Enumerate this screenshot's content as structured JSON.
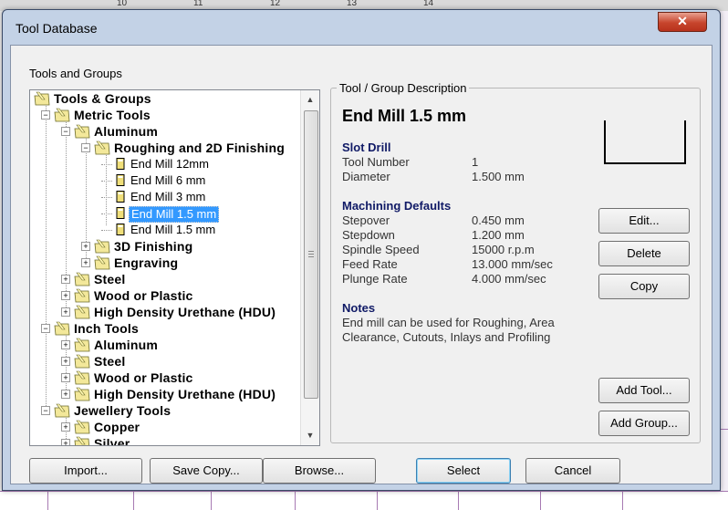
{
  "dialog": {
    "title": "Tool Database",
    "close_glyph": "✕"
  },
  "tree": {
    "group_label": "Tools and Groups",
    "nodes": [
      {
        "label": "Tools & Groups",
        "kind": "folder",
        "level": 0,
        "expander": "",
        "bold": true
      },
      {
        "label": "Metric Tools",
        "kind": "folder",
        "level": 1,
        "expander": "−",
        "bold": true
      },
      {
        "label": "Aluminum",
        "kind": "folder",
        "level": 2,
        "expander": "−",
        "bold": true
      },
      {
        "label": "Roughing and 2D Finishing",
        "kind": "folder",
        "level": 3,
        "expander": "−",
        "bold": true
      },
      {
        "label": "End Mill 12mm",
        "kind": "tool",
        "level": 4,
        "expander": "",
        "bold": false
      },
      {
        "label": "End Mill 6 mm",
        "kind": "tool",
        "level": 4,
        "expander": "",
        "bold": false
      },
      {
        "label": "End Mill 3 mm",
        "kind": "tool",
        "level": 4,
        "expander": "",
        "bold": false
      },
      {
        "label": "End Mill 1.5 mm",
        "kind": "tool",
        "level": 4,
        "expander": "",
        "bold": false,
        "selected": true
      },
      {
        "label": "End Mill 1.5 mm",
        "kind": "tool",
        "level": 4,
        "expander": "",
        "bold": false
      },
      {
        "label": "3D Finishing",
        "kind": "folder",
        "level": 3,
        "expander": "+",
        "bold": true
      },
      {
        "label": "Engraving",
        "kind": "folder",
        "level": 3,
        "expander": "+",
        "bold": true
      },
      {
        "label": "Steel",
        "kind": "folder",
        "level": 2,
        "expander": "+",
        "bold": true
      },
      {
        "label": "Wood or Plastic",
        "kind": "folder",
        "level": 2,
        "expander": "+",
        "bold": true
      },
      {
        "label": "High Density Urethane (HDU)",
        "kind": "folder",
        "level": 2,
        "expander": "+",
        "bold": true
      },
      {
        "label": "Inch Tools",
        "kind": "folder",
        "level": 1,
        "expander": "−",
        "bold": true
      },
      {
        "label": "Aluminum",
        "kind": "folder",
        "level": 2,
        "expander": "+",
        "bold": true
      },
      {
        "label": "Steel",
        "kind": "folder",
        "level": 2,
        "expander": "+",
        "bold": true
      },
      {
        "label": "Wood or Plastic",
        "kind": "folder",
        "level": 2,
        "expander": "+",
        "bold": true
      },
      {
        "label": "High Density Urethane (HDU)",
        "kind": "folder",
        "level": 2,
        "expander": "+",
        "bold": true
      },
      {
        "label": "Jewellery Tools",
        "kind": "folder",
        "level": 1,
        "expander": "−",
        "bold": true
      },
      {
        "label": "Copper",
        "kind": "folder",
        "level": 2,
        "expander": "+",
        "bold": true
      },
      {
        "label": "Silver",
        "kind": "folder",
        "level": 2,
        "expander": "+",
        "bold": true
      }
    ],
    "scroll_up_glyph": "▲",
    "scroll_down_glyph": "▼"
  },
  "description": {
    "legend": "Tool / Group Description",
    "heading": "End Mill 1.5 mm",
    "tool_type": "Slot Drill",
    "tool_fields": [
      {
        "key": "Tool Number",
        "value": "1"
      },
      {
        "key": "Diameter",
        "value": "1.500 mm"
      }
    ],
    "defaults_title": "Machining Defaults",
    "defaults": [
      {
        "key": "Stepover",
        "value": "0.450 mm"
      },
      {
        "key": "Stepdown",
        "value": "1.200 mm"
      },
      {
        "key": "Spindle Speed",
        "value": "15000 r.p.m"
      },
      {
        "key": "Feed Rate",
        "value": "13.000 mm/sec"
      },
      {
        "key": "Plunge Rate",
        "value": "4.000 mm/sec"
      }
    ],
    "notes_title": "Notes",
    "notes": "End mill can be used for Roughing, Area Clearance, Cutouts, Inlays and Profiling"
  },
  "buttons": {
    "edit": "Edit...",
    "delete": "Delete",
    "copy": "Copy",
    "add_tool": "Add Tool...",
    "add_group": "Add Group...",
    "import": "Import...",
    "save_copy": "Save Copy...",
    "browse": "Browse...",
    "select": "Select",
    "cancel": "Cancel"
  },
  "background": {
    "ruler_numbers": [
      "10",
      "11",
      "12",
      "13",
      "14"
    ]
  },
  "colors": {
    "selection": "#3399ff",
    "section_heading": "#101a66",
    "close_button": "#c7452d",
    "window_frame": "#c3d2e6"
  }
}
